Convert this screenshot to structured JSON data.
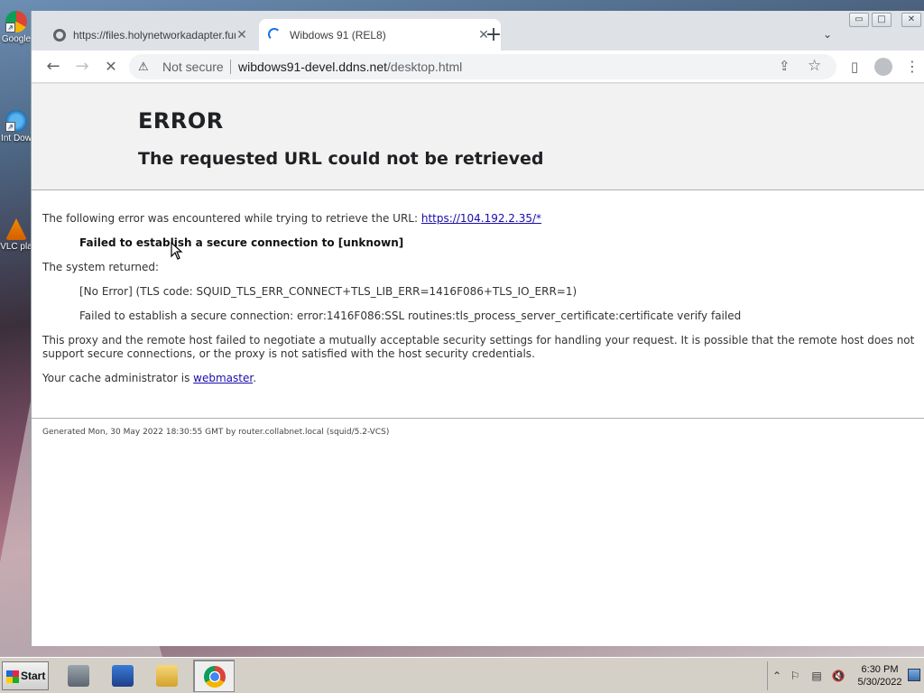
{
  "desktop": {
    "icons": [
      {
        "label": "Google",
        "icon": "chrome-shortcut-icon"
      },
      {
        "label": "Int Dow",
        "icon": "internet-download-shortcut-icon"
      },
      {
        "label": "VLC pla",
        "icon": "vlc-shortcut-icon"
      }
    ]
  },
  "browser": {
    "tabs": [
      {
        "title": "https://files.holynetworkadapter.fun",
        "close": "✕"
      },
      {
        "title": "Wibdows 91 (REL8)",
        "close": "✕"
      }
    ],
    "new_tab": "+",
    "tab_search": "⌄",
    "window_controls": {
      "minimize": "▭",
      "maximize": "□",
      "close": "✕"
    },
    "nav": {
      "back": "←",
      "forward": "→",
      "stop": "✕"
    },
    "address": {
      "security_label": "Not secure",
      "host": "wibdows91-devel.ddns.net",
      "path": "/desktop.html"
    }
  },
  "page": {
    "heading": "ERROR",
    "subheading": "The requested URL could not be retrieved",
    "intro": "The following error was encountered while trying to retrieve the URL: ",
    "intro_link": "https://104.192.2.35/*",
    "error_title": "Failed to establish a secure connection to [unknown]",
    "system_returned": "The system returned:",
    "system_code": "[No Error] (TLS code: SQUID_TLS_ERR_CONNECT+TLS_LIB_ERR=1416F086+TLS_IO_ERR=1)",
    "system_detail": "Failed to establish a secure connection: error:1416F086:SSL routines:tls_process_server_certificate:certificate verify failed",
    "explanation": "This proxy and the remote host failed to negotiate a mutually acceptable security settings for handling your request. It is possible that the remote host does not support secure connections, or the proxy is not satisfied with the host security credentials.",
    "admin_prefix": "Your cache administrator is ",
    "admin_link": "webmaster",
    "admin_suffix": ".",
    "footer": "Generated Mon, 30 May 2022 18:30:55 GMT by router.collabnet.local (squid/5.2-VCS)"
  },
  "taskbar": {
    "start_label": "Start",
    "apps": [
      "server-manager-icon",
      "powershell-icon",
      "file-explorer-icon",
      "chrome-icon"
    ],
    "clock_time": "6:30 PM",
    "clock_date": "5/30/2022",
    "tray_icons": [
      "show-hidden-icons-icon",
      "action-center-flag-icon",
      "network-icon",
      "volume-muted-icon"
    ]
  },
  "colors": {
    "link": "#1a0dab",
    "error_header_bg": "#f2f2f2",
    "chrome_tab_bg": "#dee1e6",
    "taskbar": "#d4d0c8"
  }
}
